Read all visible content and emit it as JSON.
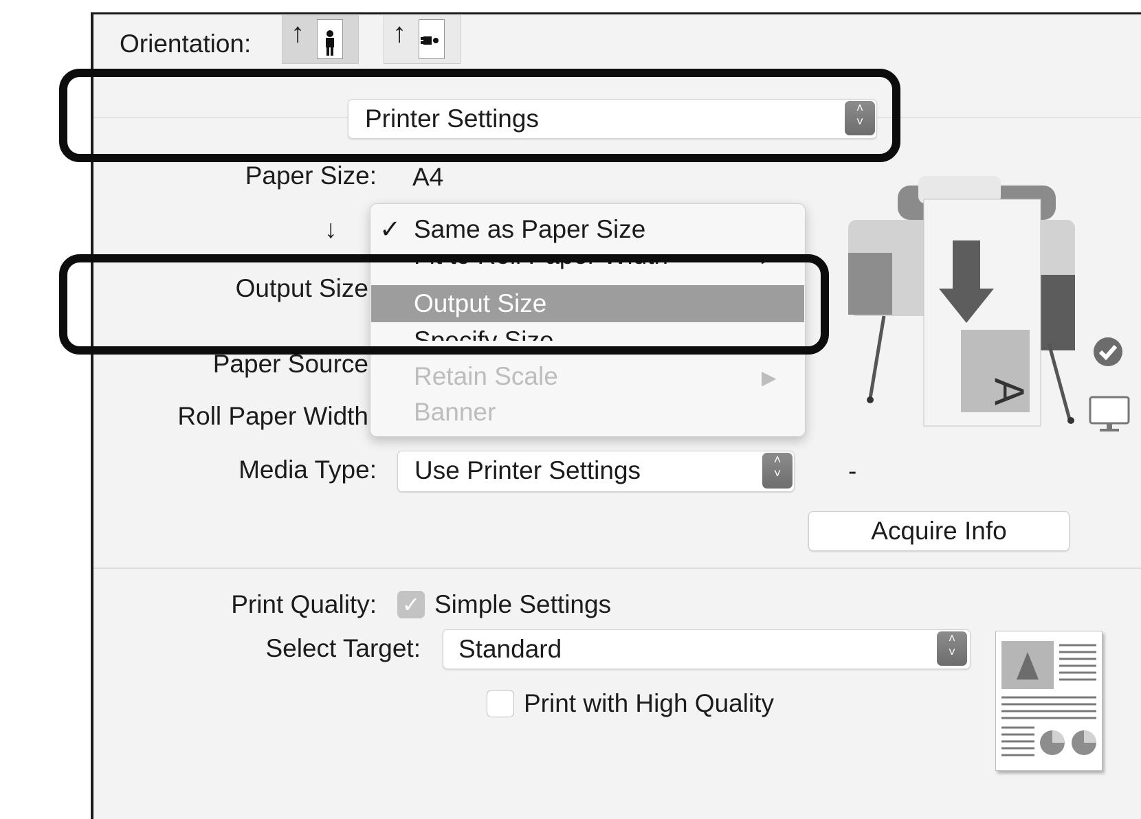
{
  "orientation": {
    "label": "Orientation:",
    "portrait_icon": "portrait-orientation-icon",
    "landscape_icon": "landscape-orientation-icon"
  },
  "panel_selector": {
    "value": "Printer Settings"
  },
  "paper_size": {
    "label": "Paper Size:",
    "value": "A4"
  },
  "down_arrow": "↓",
  "output_size": {
    "label": "Output Size"
  },
  "paper_source": {
    "label": "Paper Source"
  },
  "roll_paper_width": {
    "label": "Roll Paper Width"
  },
  "output_menu": {
    "items": [
      {
        "label": "Same as Paper Size",
        "checked": true,
        "enabled": true
      },
      {
        "label": "Fit to Roll Paper Width",
        "submenu": true,
        "enabled": true
      },
      {
        "label": "Output Size",
        "highlighted": true,
        "enabled": true
      },
      {
        "label": "Specify Size…",
        "enabled": true
      },
      {
        "label": "Retain Scale",
        "submenu": true,
        "enabled": false
      },
      {
        "label": "Banner",
        "enabled": false
      }
    ],
    "checkmark": "✓",
    "submenu_arrow": "▶"
  },
  "media_type": {
    "label": "Media Type:",
    "value": "Use Printer Settings",
    "status": "-"
  },
  "acquire_info_button": "Acquire Info",
  "print_quality": {
    "label": "Print Quality:",
    "simple_settings_label": "Simple Settings",
    "simple_settings_checked": true
  },
  "select_target": {
    "label": "Select Target:",
    "value": "Standard"
  },
  "high_quality": {
    "label": "Print with High Quality",
    "checked": false
  },
  "stepper_glyph_up": "˄",
  "stepper_glyph_down": "˅",
  "icons": {
    "printer_preview": "large-format-printer-icon",
    "connection_ok": "checkmark-circle-icon",
    "computer": "monitor-icon",
    "document_preview": "document-preview-icon"
  },
  "colors": {
    "highlight_box": "#0d0d0d",
    "menu_highlight": "#9d9d9d",
    "stepper": "#7a7a7a"
  }
}
